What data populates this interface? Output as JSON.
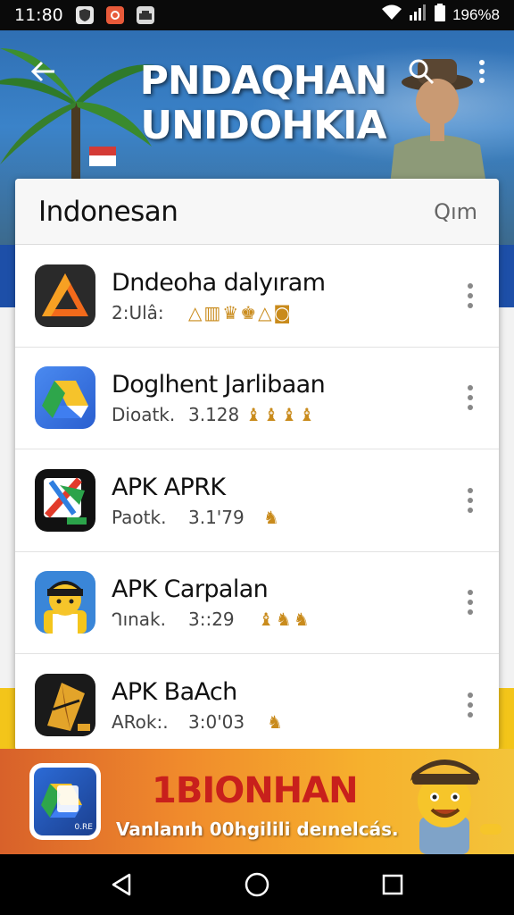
{
  "status_bar": {
    "time": "11:80",
    "battery": "196%8",
    "icons": [
      "shield-notif-icon",
      "app-notif-icon",
      "image-notif-icon",
      "wifi-icon",
      "signal-icon",
      "battery-icon"
    ]
  },
  "header": {
    "title_line1": "PNDAQHAN",
    "title_line2": "UNIDOHKIA",
    "icons": [
      "back-arrow-icon",
      "search-icon",
      "more-vert-icon"
    ]
  },
  "card": {
    "title": "Indonesan",
    "action": "Qım"
  },
  "apps": [
    {
      "name": "Dndeoha dalyıram",
      "dev": "2:Ulâ:",
      "size": "",
      "stars": "△▥♛♚△◙",
      "icon": "orange-triangle-icon"
    },
    {
      "name": "Doglhent Jarlibaan",
      "dev": "Dioatk.",
      "size": "3.128",
      "stars": "♝♝♝♝",
      "icon": "blue-drive-icon"
    },
    {
      "name": "APK APRK",
      "dev": "Paotk.",
      "size": "3.1'79",
      "stars": "♞",
      "icon": "dark-apk-icon"
    },
    {
      "name": "APK Carpalan",
      "dev": "ᒉınak.",
      "size": "3::29",
      "stars": "♝♞♞",
      "icon": "yellow-character-icon"
    },
    {
      "name": "APK BaAch",
      "dev": "ARok:.",
      "size": "3:0'03",
      "stars": "♞",
      "icon": "gold-wing-icon"
    }
  ],
  "promo": {
    "title": "1BIONHAN",
    "subtitle": "Vanlanıh 00hgilili deınelcás.",
    "icon_label": "0.RE"
  },
  "nav": {
    "icons": [
      "back-triangle-icon",
      "home-circle-icon",
      "recents-square-icon"
    ]
  },
  "colors": {
    "promo_title": "#c8201c",
    "stripe_blue": "#1d4fa8",
    "stripe_yellow": "#f3c51a",
    "star_gold": "#c98b1c"
  }
}
